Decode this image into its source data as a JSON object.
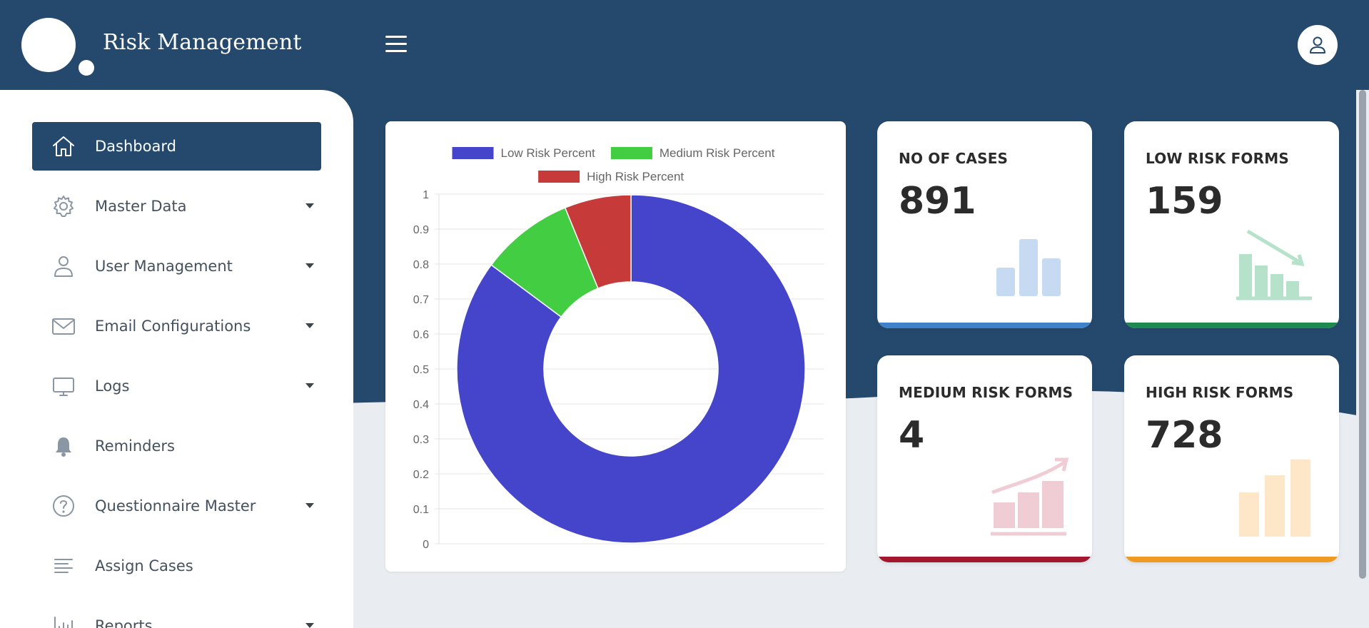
{
  "app": {
    "title": "Risk Management"
  },
  "header": {
    "menu_icon": "hamburger-menu-icon",
    "user_icon": "user-icon"
  },
  "sidebar": {
    "items": [
      {
        "label": "Dashboard",
        "icon": "home-icon",
        "active": true,
        "has_submenu": false
      },
      {
        "label": "Master Data",
        "icon": "gear-icon",
        "active": false,
        "has_submenu": true
      },
      {
        "label": "User Management",
        "icon": "user-icon",
        "active": false,
        "has_submenu": true
      },
      {
        "label": "Email Configurations",
        "icon": "envelope-icon",
        "active": false,
        "has_submenu": true
      },
      {
        "label": "Logs",
        "icon": "monitor-icon",
        "active": false,
        "has_submenu": true
      },
      {
        "label": "Reminders",
        "icon": "bell-icon",
        "active": false,
        "has_submenu": false
      },
      {
        "label": "Questionnaire Master",
        "icon": "question-circle-icon",
        "active": false,
        "has_submenu": true
      },
      {
        "label": "Assign Cases",
        "icon": "align-left-icon",
        "active": false,
        "has_submenu": false
      },
      {
        "label": "Reports",
        "icon": "bar-chart-icon",
        "active": false,
        "has_submenu": true
      }
    ]
  },
  "stats": [
    {
      "title": "NO OF CASES",
      "value": "891",
      "color": "#3f82c9",
      "illustration": "bar-chart-icon"
    },
    {
      "title": "LOW RISK FORMS",
      "value": "159",
      "color": "#1e8a50",
      "illustration": "trend-down-chart-icon"
    },
    {
      "title": "MEDIUM RISK FORMS",
      "value": "4",
      "color": "#a3172e",
      "illustration": "trend-up-chart-icon"
    },
    {
      "title": "HIGH RISK FORMS",
      "value": "728",
      "color": "#ef9a22",
      "illustration": "bar-chart-icon"
    }
  ],
  "colors": {
    "header": "#25496d",
    "low": "#4545cb",
    "medium": "#43cd43",
    "high": "#c73a3a"
  },
  "chart_data": {
    "type": "pie",
    "variant": "doughnut",
    "series": [
      {
        "name": "Low Risk Percent",
        "value": 0.8519,
        "color": "#4545cb"
      },
      {
        "name": "Medium Risk Percent",
        "value": 0.0864,
        "color": "#43cd43"
      },
      {
        "name": "High Risk Percent",
        "value": 0.0617,
        "color": "#c73a3a"
      }
    ],
    "y_ticks": [
      "1",
      "0.9",
      "0.8",
      "0.7",
      "0.6",
      "0.5",
      "0.4",
      "0.3",
      "0.2",
      "0.1",
      "0"
    ],
    "ylim": [
      0,
      1
    ],
    "grid": true,
    "legend_position": "top"
  }
}
